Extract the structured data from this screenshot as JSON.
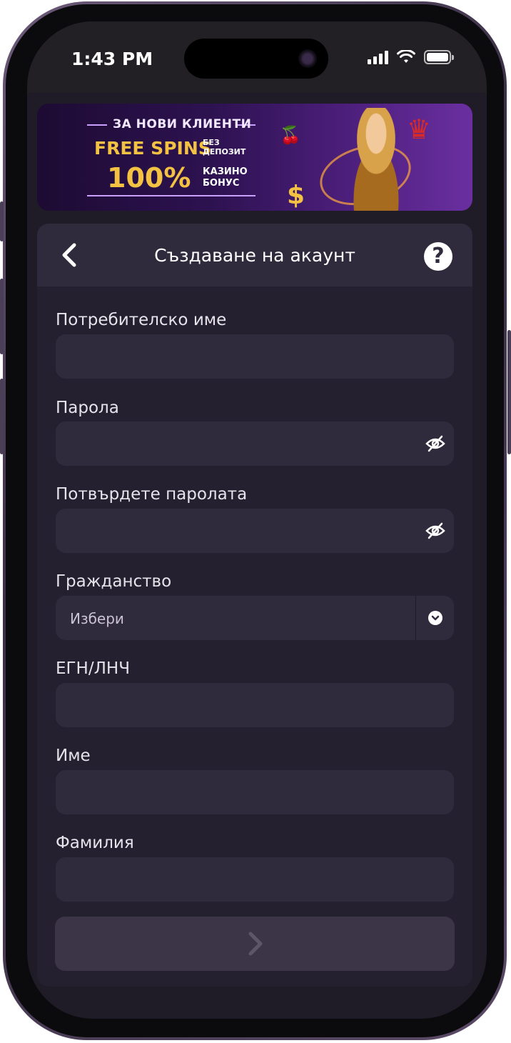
{
  "status_bar": {
    "time": "1:43 PM"
  },
  "banner": {
    "headline": "ЗА НОВИ КЛИЕНТИ",
    "free_spins": "FREE SPINS",
    "no_deposit": "БЕЗ ДЕПОЗИТ",
    "no_deposit_line1": "БЕЗ",
    "no_deposit_line2": "ДЕПОЗИТ",
    "percent": "100%",
    "casino_bonus_line1": "КАЗИНО",
    "casino_bonus_line2": "БОНУС"
  },
  "header": {
    "title": "Създаване на акаунт",
    "back_icon": "chevron-left-icon",
    "help_label": "?"
  },
  "form": {
    "username_label": "Потребителско име",
    "username_value": "",
    "password_label": "Парола",
    "password_value": "",
    "confirm_label": "Потвърдете паролата",
    "confirm_value": "",
    "citizenship_label": "Гражданство",
    "citizenship_selected": "Избери",
    "egn_label": "ЕГН/ЛНЧ",
    "egn_value": "",
    "first_name_label": "Име",
    "first_name_value": "",
    "last_name_label": "Фамилия",
    "last_name_value": ""
  },
  "colors": {
    "card_background": "#252030",
    "input_background": "#302a3d",
    "accent_gold": "#f4c243"
  }
}
